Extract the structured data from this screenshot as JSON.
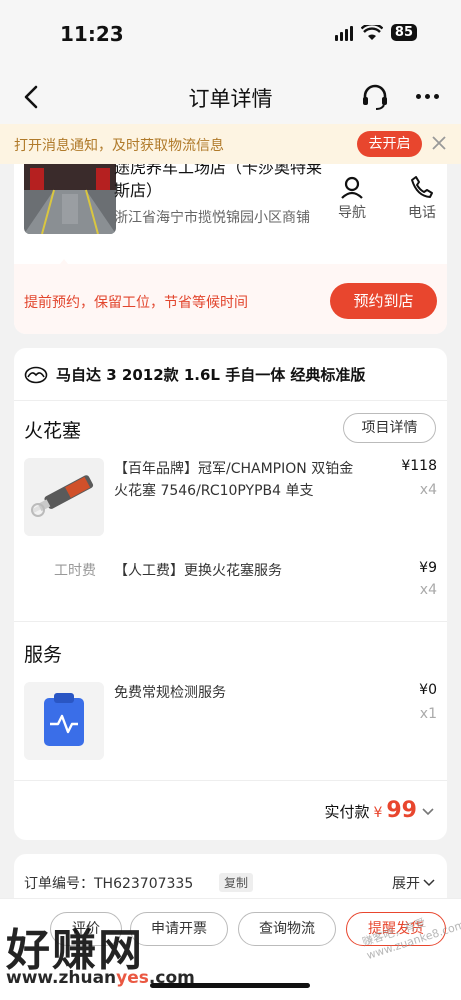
{
  "status_bar": {
    "time": "11:23",
    "battery": "85"
  },
  "nav": {
    "title": "订单详情"
  },
  "notify": {
    "text": "打开消息通知，及时获取物流信息",
    "button": "去开启"
  },
  "shop": {
    "name": "途虎养车工场店（卡莎奥特莱斯店）",
    "address": "浙江省海宁市揽悦锦园小区商铺",
    "nav_label": "导航",
    "phone_label": "电话",
    "promo": "提前预约，保留工位，节省等候时间",
    "book_button": "预约到店"
  },
  "order": {
    "car": "马自达 3 2012款 1.6L 手自一体 经典标准版",
    "section_spark": "火花塞",
    "detail_button": "项目详情",
    "product": {
      "name": "【百年品牌】冠军/CHAMPION 双铂金火花塞 7546/RC10PYPB4 单支",
      "price": "¥118",
      "qty": "x4"
    },
    "labor": {
      "label": "工时费",
      "name": "【人工费】更换火花塞服务",
      "price": "¥9",
      "qty": "x4"
    },
    "section_service": "服务",
    "service": {
      "name": "免费常规检测服务",
      "price": "¥0",
      "qty": "x1"
    },
    "total_label": "实付款",
    "total_symbol": "¥",
    "total_value": "99"
  },
  "info": {
    "order_no": "订单编号：TH623707335",
    "copy": "复制",
    "expand": "展开"
  },
  "bottom": {
    "btn1": "评价",
    "btn2": "申请开票",
    "btn3": "查询物流",
    "btn4": "提醒发货"
  },
  "watermark": {
    "big": "好赚网",
    "url_a": "www.zhuan",
    "url_b": "yes",
    "url_c": ".com",
    "stamp": "赚客吧，有爱 www.zuanke8.com"
  },
  "colors": {
    "accent": "#e8462e",
    "notify_bg": "#fdf4e2",
    "notify_text": "#b07a2a"
  }
}
